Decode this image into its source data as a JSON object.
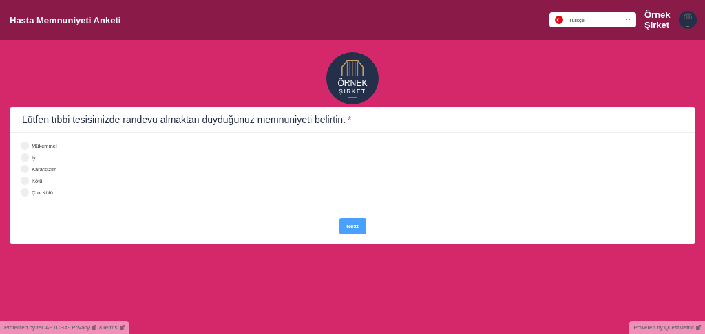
{
  "header": {
    "title": "Hasta Memnuniyeti Anketi",
    "language": "Türkçe",
    "company": "Örnek Şirket"
  },
  "logo": {
    "name": "ÖRNEK",
    "subtitle": "ŞIRKET"
  },
  "question": {
    "text": "Lütfen tıbbi tesisimizde randevu almaktan duyduğunuz memnuniyeti belirtin.",
    "required_mark": "*"
  },
  "options": [
    {
      "label": "Mükemmel",
      "selected": false
    },
    {
      "label": "İyi",
      "selected": false
    },
    {
      "label": "Kararsızım",
      "selected": false
    },
    {
      "label": "Kötü",
      "selected": false
    },
    {
      "label": "Çok Kötü",
      "selected": false
    }
  ],
  "next_button": "Next",
  "footer_left": {
    "text": "Protected by reCAPTCHA·",
    "links": [
      "Privacy",
      "&Terms"
    ]
  },
  "footer_right": {
    "text": "Powered by QuestMetric"
  }
}
